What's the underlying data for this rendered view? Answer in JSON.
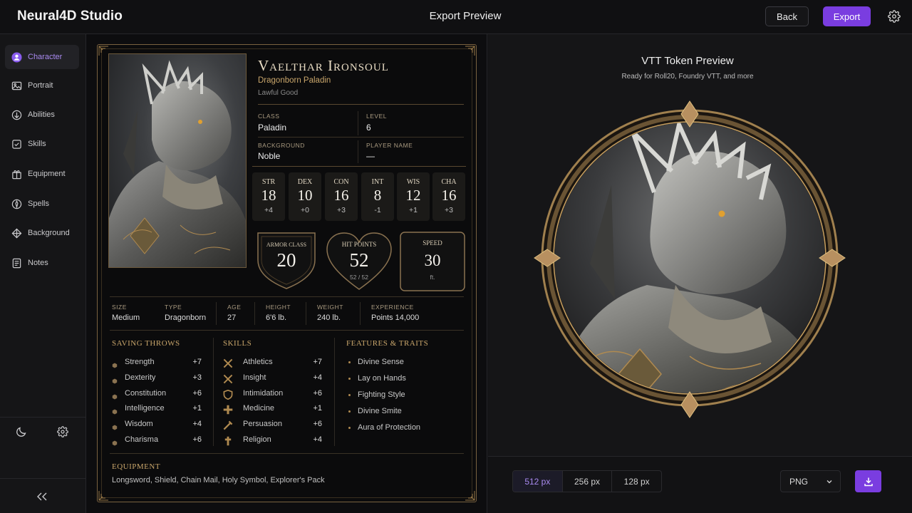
{
  "app": {
    "brand": "Neural4D Studio",
    "title": "Export Preview",
    "back_label": "Back",
    "export_label": "Export",
    "accent": "#7a3de0"
  },
  "sidebar": {
    "items": [
      {
        "label": "Character",
        "icon": "character-icon",
        "active": true
      },
      {
        "label": "Portrait",
        "icon": "portrait-icon"
      },
      {
        "label": "Abilities",
        "icon": "abilities-icon"
      },
      {
        "label": "Skills",
        "icon": "skills-icon"
      },
      {
        "label": "Equipment",
        "icon": "equipment-icon"
      },
      {
        "label": "Spells",
        "icon": "spells-icon"
      },
      {
        "label": "Background",
        "icon": "background-icon"
      },
      {
        "label": "Notes",
        "icon": "notes-icon"
      }
    ]
  },
  "character": {
    "name": "Vaelthar Ironsoul",
    "race_class": "Dragonborn Paladin",
    "alignment": "Lawful Good",
    "class_label": "CLASS",
    "class_value": "Paladin",
    "level_label": "LEVEL",
    "level_value": "6",
    "background_label": "BACKGROUND",
    "background_value": "Noble",
    "player_label": "PLAYER NAME",
    "player_value": "—",
    "abilities": [
      {
        "abbr": "STR",
        "score": "18",
        "mod": "+4"
      },
      {
        "abbr": "DEX",
        "score": "10",
        "mod": "+0"
      },
      {
        "abbr": "CON",
        "score": "16",
        "mod": "+3"
      },
      {
        "abbr": "INT",
        "score": "8",
        "mod": "-1"
      },
      {
        "abbr": "WIS",
        "score": "12",
        "mod": "+1"
      },
      {
        "abbr": "CHA",
        "score": "16",
        "mod": "+3"
      }
    ],
    "armor_class": {
      "label": "ARMOR CLASS",
      "value": "20"
    },
    "hit_points": {
      "label": "HIT POINTS",
      "value": "52",
      "sub": "52 / 52"
    },
    "speed": {
      "label": "SPEED",
      "value": "30",
      "unit": "ft."
    },
    "physical": [
      {
        "label": "SIZE",
        "value": "Medium"
      },
      {
        "label": "TYPE",
        "value": "Dragonborn"
      },
      {
        "label": "AGE",
        "value": "27"
      },
      {
        "label": "HEIGHT",
        "value": "6'6 lb."
      },
      {
        "label": "WEIGHT",
        "value": "240 lb."
      },
      {
        "label": "EXPERIENCE",
        "value": "Points 14,000"
      }
    ],
    "saving_throws_title": "SAVING THROWS",
    "saving_throws": [
      {
        "name": "Strength",
        "value": "+7"
      },
      {
        "name": "Dexterity",
        "value": "+3"
      },
      {
        "name": "Constitution",
        "value": "+6"
      },
      {
        "name": "Intelligence",
        "value": "+1"
      },
      {
        "name": "Wisdom",
        "value": "+4"
      },
      {
        "name": "Charisma",
        "value": "+6"
      }
    ],
    "skills_title": "SKILLS",
    "skills": [
      {
        "name": "Athletics",
        "value": "+7"
      },
      {
        "name": "Insight",
        "value": "+4"
      },
      {
        "name": "Intimidation",
        "value": "+6"
      },
      {
        "name": "Medicine",
        "value": "+1"
      },
      {
        "name": "Persuasion",
        "value": "+6"
      },
      {
        "name": "Religion",
        "value": "+4"
      }
    ],
    "features_title": "FEATURES & TRAITS",
    "features": [
      "Divine Sense",
      "Lay on Hands",
      "Fighting Style",
      "Divine Smite",
      "Aura of Protection"
    ],
    "equipment_title": "EQUIPMENT",
    "equipment": "Longsword, Shield, Chain Mail, Holy Symbol, Explorer's Pack"
  },
  "preview": {
    "title": "VTT Token Preview",
    "subtitle": "Ready for Roll20, Foundry VTT, and more",
    "sizes": [
      "512 px",
      "256 px",
      "128 px"
    ],
    "selected_size": "512 px",
    "format": "PNG"
  }
}
